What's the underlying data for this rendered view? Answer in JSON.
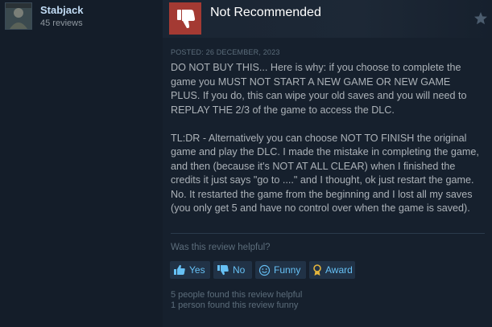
{
  "reviewer": {
    "username": "Stabjack",
    "review_count": "45 reviews"
  },
  "review": {
    "verdict": "Not Recommended",
    "posted": "POSTED: 26 DECEMBER, 2023",
    "paragraph_1": "DO NOT BUY THIS... Here is why: if you choose to complete the game you MUST NOT START A NEW GAME OR NEW GAME PLUS. If you do, this can wipe your old saves and you will need to REPLAY THE 2/3 of the game to access the DLC.",
    "paragraph_2": "TL:DR - Alternatively you can choose NOT TO FINISH the original game and play the DLC. I made the mistake in completing the game, and then (because it's NOT AT ALL CLEAR) when I finished the credits it just says \"go to ....\" and I thought, ok just restart the game. No. It restarted the game from the beginning and I lost all my saves (you only get 5 and have no control over when the game is saved)."
  },
  "feedback": {
    "question": "Was this review helpful?",
    "yes_label": "Yes",
    "no_label": "No",
    "funny_label": "Funny",
    "award_label": "Award",
    "helpful_count_text": "5 people found this review helpful",
    "funny_count_text": "1 person found this review funny"
  },
  "icons": {
    "verdict": "thumbs-down-icon",
    "award_star": "star-icon",
    "yes": "thumbs-up-icon",
    "no": "thumbs-down-icon",
    "funny": "smiley-icon",
    "award": "award-ribbon-icon"
  },
  "colors": {
    "verdict_box": "#a43a33",
    "accent": "#66c0f4",
    "award_icon": "#e5b53c"
  }
}
